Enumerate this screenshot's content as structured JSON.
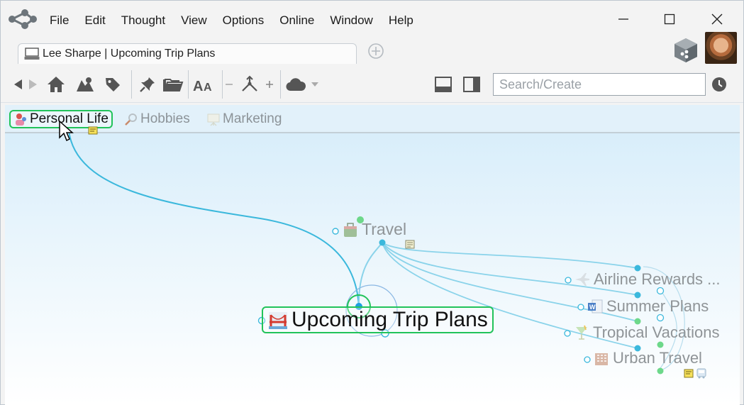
{
  "menu": [
    "File",
    "Edit",
    "Thought",
    "View",
    "Options",
    "Online",
    "Window",
    "Help"
  ],
  "tab": {
    "label": "Lee Sharpe | Upcoming Trip Plans"
  },
  "search": {
    "placeholder": "Search/Create"
  },
  "pins": [
    {
      "label": "Personal Life",
      "icon": "person-icon",
      "active": true
    },
    {
      "label": "Hobbies",
      "icon": "magnifier-icon",
      "active": false
    },
    {
      "label": "Marketing",
      "icon": "presentation-icon",
      "active": false
    }
  ],
  "thoughts": {
    "parent": "Travel",
    "central": "Upcoming Trip Plans",
    "children": [
      "Airline Rewards ...",
      "Summer Plans",
      "Tropical Vacations",
      "Urban Travel"
    ]
  },
  "colors": {
    "accent_green": "#22c35a",
    "link_blue": "#3bb8dc",
    "node_blue": "#2aa7df"
  }
}
